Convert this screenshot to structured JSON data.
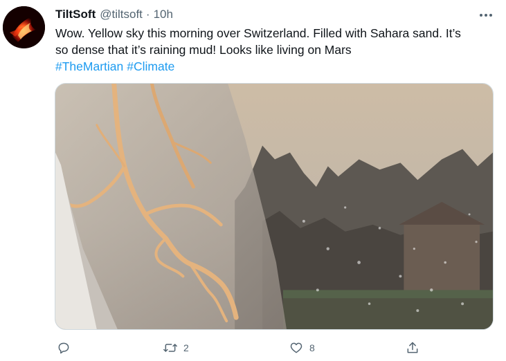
{
  "tweet": {
    "display_name": "TiltSoft",
    "handle": "@tiltsoft",
    "separator": "·",
    "time": "10h",
    "text_line1": "Wow. Yellow sky this morning over Switzerland. Filled with Sahara sand. It’s",
    "text_line2": "so dense that it’s raining mud! Looks like living on Mars",
    "hashtags": [
      "#TheMartian",
      "#Climate"
    ],
    "media_icon": "photo-of-muddy-car-windshield"
  },
  "actions": {
    "reply_count": "",
    "retweet_count": "2",
    "like_count": "8",
    "icons": [
      "reply-icon",
      "retweet-icon",
      "like-icon",
      "share-icon"
    ]
  },
  "colors": {
    "accent": "#1d9bf0",
    "secondary_text": "#536471",
    "primary_text": "#0f1419"
  }
}
